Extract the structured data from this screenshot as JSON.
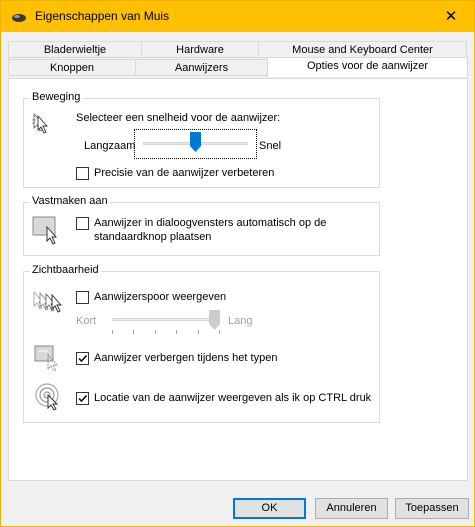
{
  "window": {
    "title": "Eigenschappen van Muis",
    "close_glyph": "✕"
  },
  "tabs": {
    "row1": [
      {
        "label": "Bladerwieltje"
      },
      {
        "label": "Hardware"
      },
      {
        "label": "Mouse and Keyboard Center"
      }
    ],
    "row2": [
      {
        "label": "Knoppen"
      },
      {
        "label": "Aanwijzers"
      },
      {
        "label": "Opties voor de aanwijzer",
        "active": true
      }
    ]
  },
  "motion": {
    "legend": "Beweging",
    "prompt": "Selecteer een snelheid voor de aanwijzer:",
    "slow_label": "Langzaam",
    "fast_label": "Snel",
    "speed_level": 0.5,
    "precision": {
      "label": "Precisie van de aanwijzer verbeteren",
      "checked": false
    }
  },
  "snap": {
    "legend": "Vastmaken aan",
    "option": {
      "label_line1": "Aanwijzer in dialoogvensters automatisch op de",
      "label_line2": "standaardknop plaatsen",
      "checked": false
    }
  },
  "visibility": {
    "legend": "Zichtbaarheid",
    "trails": {
      "label": "Aanwijzerspoor weergeven",
      "checked": false,
      "short_label": "Kort",
      "long_label": "Lang",
      "level": 1.0
    },
    "hide_typing": {
      "label": "Aanwijzer verbergen tijdens het typen",
      "checked": true
    },
    "ctrl_location": {
      "label": "Locatie van de aanwijzer weergeven als ik op CTRL druk",
      "checked": true
    }
  },
  "buttons": {
    "ok": "OK",
    "cancel": "Annuleren",
    "apply": "Toepassen"
  }
}
